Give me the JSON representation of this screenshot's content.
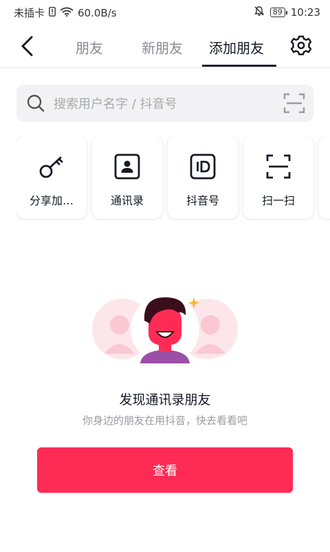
{
  "status_bar": {
    "carrier": "未插卡",
    "speed": "60.0B/s",
    "battery": "89",
    "time": "10:23"
  },
  "nav": {
    "tabs": [
      {
        "label": "朋友",
        "active": false
      },
      {
        "label": "新朋友",
        "active": false
      },
      {
        "label": "添加朋友",
        "active": true
      }
    ]
  },
  "search": {
    "placeholder": "搜索用户名字 / 抖音号"
  },
  "quick_actions": [
    {
      "label": "分享加…",
      "icon": "key-icon"
    },
    {
      "label": "通讯录",
      "icon": "contacts-icon"
    },
    {
      "label": "抖音号",
      "icon": "id-icon"
    },
    {
      "label": "扫一扫",
      "icon": "scan-icon"
    }
  ],
  "empty_state": {
    "title": "发现通讯录朋友",
    "subtitle": "你身边的朋友在用抖音，快去看看吧",
    "button_label": "查看"
  },
  "colors": {
    "accent": "#fe2c55",
    "text": "#161823",
    "muted": "#9a9ba0",
    "search_bg": "#f2f2f4"
  }
}
